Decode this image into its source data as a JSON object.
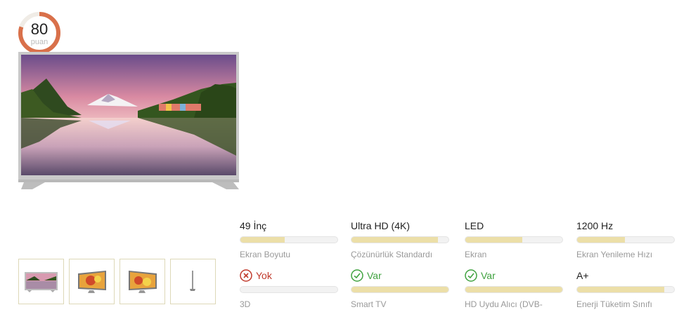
{
  "score": {
    "value": "80",
    "unit": "puan",
    "fraction": 0.8,
    "color": "#d9704a"
  },
  "product": {
    "image_icon": "tv-image"
  },
  "thumbnails": [
    {
      "icon": "tv-landscape-thumbnail"
    },
    {
      "icon": "tv-colorful-thumbnail-1"
    },
    {
      "icon": "tv-colorful-thumbnail-2"
    },
    {
      "icon": "tv-stand-thumbnail"
    }
  ],
  "specs": [
    {
      "value": "49 İnç",
      "label": "Ekran Boyutu",
      "level": 0.46
    },
    {
      "value": "Ultra HD (4K)",
      "label": "Çözünürlük Standardı",
      "level": 0.89
    },
    {
      "value": "LED",
      "label": "Ekran",
      "level": 0.59
    },
    {
      "value": "1200 Hz",
      "label": "Ekran Yenileme Hızı",
      "level": 0.49
    },
    {
      "value": "Yok",
      "label": "3D",
      "level": 0.0,
      "status": "no"
    },
    {
      "value": "Var",
      "label": "Smart TV",
      "level": 1.0,
      "status": "yes"
    },
    {
      "value": "Var",
      "label": "HD Uydu Alıcı (DVB-",
      "level": 1.0,
      "status": "yes"
    },
    {
      "value": "A+",
      "label": "Enerji Tüketim Sınıfı",
      "level": 0.9
    }
  ],
  "colors": {
    "bar_fill": "#ecdfa8",
    "no": "#c0392b",
    "yes": "#3fa23f"
  }
}
